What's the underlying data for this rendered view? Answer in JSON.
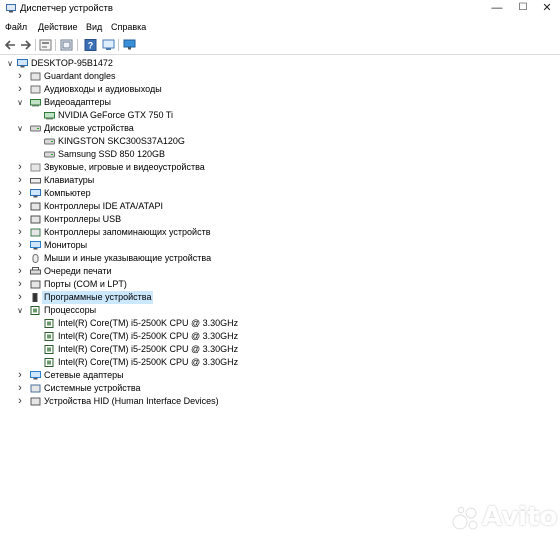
{
  "window": {
    "title": "Диспетчер устройств",
    "minimize": "—",
    "maximize": "☐",
    "close": "✕"
  },
  "menu": [
    "Файл",
    "Действие",
    "Вид",
    "Справка"
  ],
  "toolbar": [
    "back-icon",
    "forward-icon",
    "properties-icon",
    "update-driver-icon",
    "help-icon",
    "scan-hardware-icon"
  ],
  "tree": {
    "root": "DESKTOP-95B1472",
    "categories": [
      {
        "label": "Guardant dongles",
        "icon": "dongle-icon",
        "expanded": false
      },
      {
        "label": "Аудиовходы и аудиовыходы",
        "icon": "speaker-icon",
        "expanded": false
      },
      {
        "label": "Видеоадаптеры",
        "icon": "display-adapter-icon",
        "expanded": true,
        "children": [
          "NVIDIA GeForce GTX 750 Ti"
        ]
      },
      {
        "label": "Дисковые устройства",
        "icon": "disk-drive-icon",
        "expanded": true,
        "children": [
          "KINGSTON SKC300S37A120G",
          "Samsung SSD 850 120GB"
        ]
      },
      {
        "label": "Звуковые, игровые и видеоустройства",
        "icon": "sound-icon",
        "expanded": false
      },
      {
        "label": "Клавиатуры",
        "icon": "keyboard-icon",
        "expanded": false
      },
      {
        "label": "Компьютер",
        "icon": "computer-icon",
        "expanded": false
      },
      {
        "label": "Контроллеры IDE ATA/ATAPI",
        "icon": "ide-controller-icon",
        "expanded": false
      },
      {
        "label": "Контроллеры USB",
        "icon": "usb-icon",
        "expanded": false
      },
      {
        "label": "Контроллеры запоминающих устройств",
        "icon": "storage-controller-icon",
        "expanded": false
      },
      {
        "label": "Мониторы",
        "icon": "monitor-icon",
        "expanded": false
      },
      {
        "label": "Мыши и иные указывающие устройства",
        "icon": "mouse-icon",
        "expanded": false
      },
      {
        "label": "Очереди печати",
        "icon": "printer-icon",
        "expanded": false
      },
      {
        "label": "Порты (COM и LPT)",
        "icon": "port-icon",
        "expanded": false
      },
      {
        "label": "Программные устройства",
        "icon": "software-device-icon",
        "expanded": false,
        "selected": true
      },
      {
        "label": "Процессоры",
        "icon": "processor-icon",
        "expanded": true,
        "children": [
          "Intel(R) Core(TM) i5-2500K CPU @ 3.30GHz",
          "Intel(R) Core(TM) i5-2500K CPU @ 3.30GHz",
          "Intel(R) Core(TM) i5-2500K CPU @ 3.30GHz",
          "Intel(R) Core(TM) i5-2500K CPU @ 3.30GHz"
        ]
      },
      {
        "label": "Сетевые адаптеры",
        "icon": "network-adapter-icon",
        "expanded": false
      },
      {
        "label": "Системные устройства",
        "icon": "system-device-icon",
        "expanded": false
      },
      {
        "label": "Устройства HID (Human Interface Devices)",
        "icon": "hid-icon",
        "expanded": false
      }
    ]
  },
  "watermark": "Avito",
  "colors": {
    "selection": "#cce8ff",
    "accent": "#0078d7"
  }
}
